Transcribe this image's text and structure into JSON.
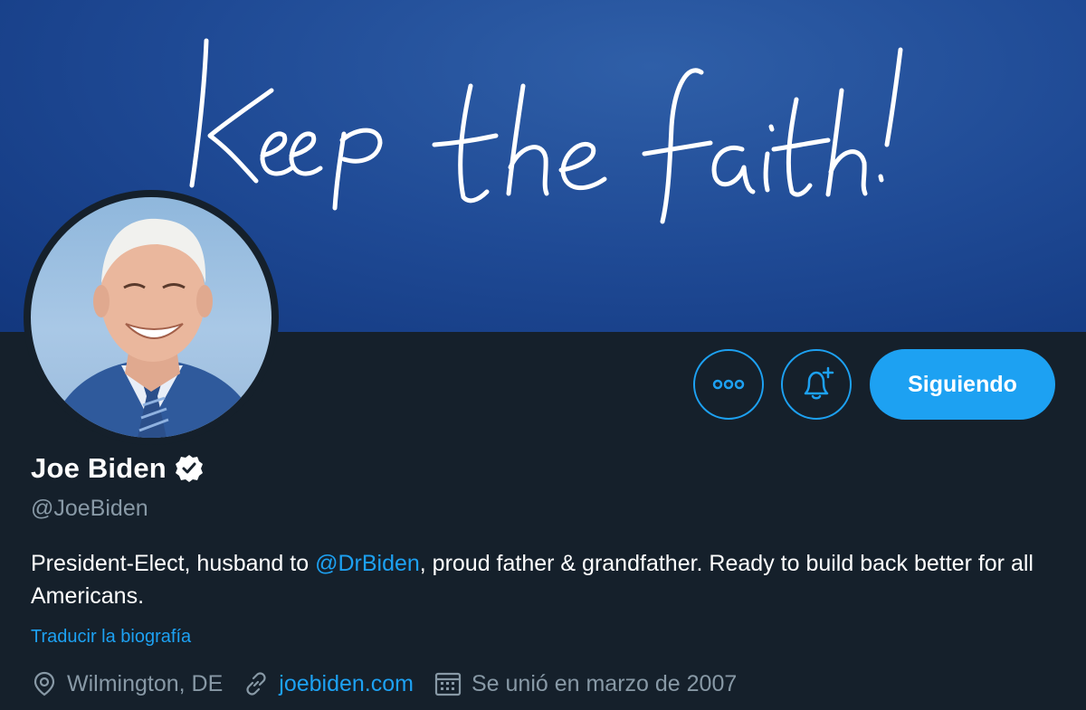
{
  "banner": {
    "handwriting": "Keep the faith!"
  },
  "profile": {
    "name": "Joe Biden",
    "handle": "@JoeBiden",
    "bio_before": "President-Elect, husband to ",
    "bio_mention": "@DrBiden",
    "bio_after": ", proud father & grandfather. Ready to build back better for all Americans.",
    "translate_label": "Traducir la biografía",
    "location": "Wilmington, DE",
    "website": "joebiden.com",
    "joined": "Se unió en marzo de 2007"
  },
  "actions": {
    "follow_label": "Siguiendo"
  },
  "icons": {
    "more": "more-icon",
    "notify": "bell-plus-icon",
    "verified": "verified-badge-icon",
    "location": "location-pin-icon",
    "link": "link-icon",
    "calendar": "calendar-icon"
  },
  "colors": {
    "background": "#15202b",
    "accent": "#1da1f2",
    "secondary_text": "#8899a6",
    "banner_blue": "#1f4a95"
  }
}
